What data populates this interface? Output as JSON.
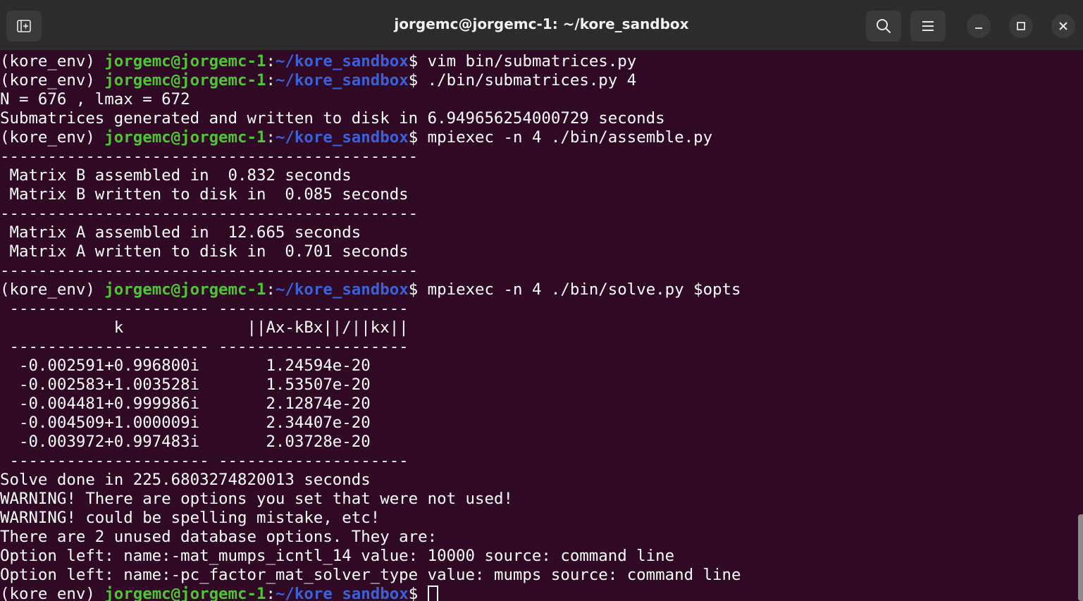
{
  "window": {
    "title": "jorgemc@jorgemc-1: ~/kore_sandbox"
  },
  "titlebar": {
    "new_tab_icon": "new-tab-icon",
    "search_icon": "search-icon",
    "menu_icon": "hamburger-menu-icon",
    "minimize_icon": "minimize-icon",
    "maximize_icon": "maximize-icon",
    "close_icon": "close-icon"
  },
  "colors": {
    "background": "#300a24",
    "user": "#4ec634",
    "path": "#3a61d9",
    "titlebar": "#2c2c2c"
  },
  "prompt": {
    "env": "(kore_env) ",
    "user": "jorgemc@jorgemc-1",
    "colon": ":",
    "path": "~/kore_sandbox",
    "symbol": "$ "
  },
  "lines": [
    {
      "type": "prompt",
      "cmd": "vim bin/submatrices.py"
    },
    {
      "type": "prompt",
      "cmd": "./bin/submatrices.py 4"
    },
    {
      "type": "text",
      "text": "N = 676 , lmax = 672"
    },
    {
      "type": "text",
      "text": "Submatrices generated and written to disk in 6.949656254000729 seconds"
    },
    {
      "type": "prompt",
      "cmd": "mpiexec -n 4 ./bin/assemble.py"
    },
    {
      "type": "text",
      "text": "--------------------------------------------"
    },
    {
      "type": "text",
      "text": " Matrix B assembled in  0.832 seconds"
    },
    {
      "type": "text",
      "text": " Matrix B written to disk in  0.085 seconds"
    },
    {
      "type": "text",
      "text": "--------------------------------------------"
    },
    {
      "type": "text",
      "text": " Matrix A assembled in  12.665 seconds"
    },
    {
      "type": "text",
      "text": " Matrix A written to disk in  0.701 seconds"
    },
    {
      "type": "text",
      "text": "--------------------------------------------"
    },
    {
      "type": "prompt",
      "cmd": "mpiexec -n 4 ./bin/solve.py $opts"
    },
    {
      "type": "text",
      "text": " --------------------- --------------------"
    },
    {
      "type": "text",
      "text": "            k             ||Ax-kBx||/||kx||"
    },
    {
      "type": "text",
      "text": " --------------------- --------------------"
    },
    {
      "type": "text",
      "text": "  -0.002591+0.996800i       1.24594e-20"
    },
    {
      "type": "text",
      "text": "  -0.002583+1.003528i       1.53507e-20"
    },
    {
      "type": "text",
      "text": "  -0.004481+0.999986i       2.12874e-20"
    },
    {
      "type": "text",
      "text": "  -0.004509+1.000009i       2.34407e-20"
    },
    {
      "type": "text",
      "text": "  -0.003972+0.997483i       2.03728e-20"
    },
    {
      "type": "text",
      "text": " --------------------- --------------------"
    },
    {
      "type": "text",
      "text": "Solve done in 225.6803274820013 seconds"
    },
    {
      "type": "text",
      "text": "WARNING! There are options you set that were not used!"
    },
    {
      "type": "text",
      "text": "WARNING! could be spelling mistake, etc!"
    },
    {
      "type": "text",
      "text": "There are 2 unused database options. They are:"
    },
    {
      "type": "text",
      "text": "Option left: name:-mat_mumps_icntl_14 value: 10000 source: command line"
    },
    {
      "type": "text",
      "text": "Option left: name:-pc_factor_mat_solver_type value: mumps source: command line"
    },
    {
      "type": "prompt",
      "cmd": "",
      "cursor": true
    }
  ]
}
